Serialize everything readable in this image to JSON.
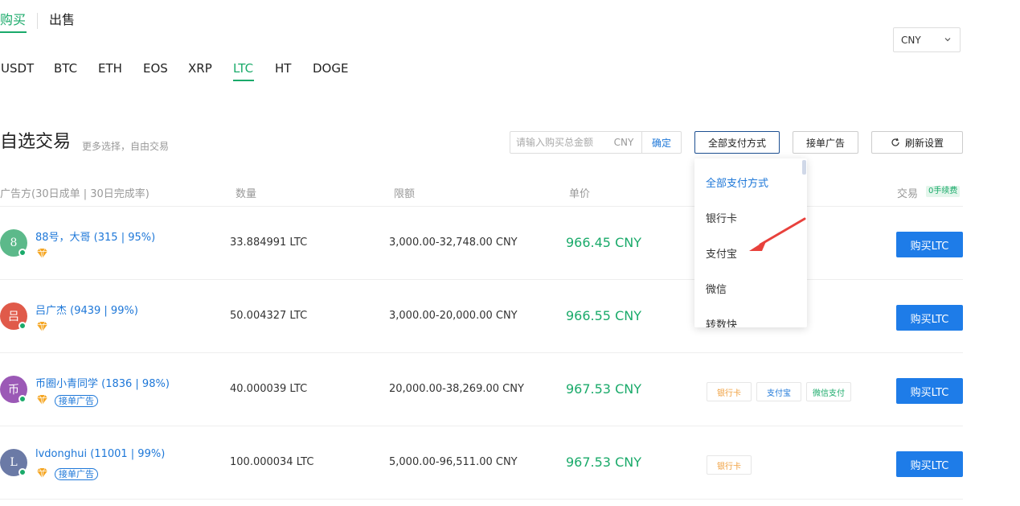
{
  "mode_tabs": {
    "buy": "购买",
    "sell": "出售"
  },
  "currency_select": {
    "value": "CNY"
  },
  "coins": [
    "USDT",
    "BTC",
    "ETH",
    "EOS",
    "XRP",
    "LTC",
    "HT",
    "DOGE"
  ],
  "active_coin": "LTC",
  "section": {
    "title": "自选交易",
    "subtitle": "更多选择，自由交易",
    "amount_placeholder": "请输入购买总金额",
    "amount_currency": "CNY",
    "confirm": "确定",
    "pay_method_button": "全部支付方式",
    "take_ad_button": "接单广告",
    "refresh_button": "刷新设置"
  },
  "table_header": {
    "advertiser": "广告方(30日成单 | 30日完成率)",
    "quantity": "数量",
    "limit": "限额",
    "price": "单价",
    "trade": "交易",
    "zero_fee": "0手续费"
  },
  "rows": [
    {
      "avatar": "8",
      "avatar_color": "#5cb98a",
      "merchant": "88号，大哥 (315 | 95%)",
      "qty": "33.884991 LTC",
      "limit": "3,000.00-32,748.00 CNY",
      "price": "966.45 CNY",
      "take_ad": "",
      "pay_tags": [],
      "buy": "购买LTC"
    },
    {
      "avatar": "吕",
      "avatar_color": "#e05a4a",
      "merchant": "吕广杰 (9439 | 99%)",
      "qty": "50.004327 LTC",
      "limit": "3,000.00-20,000.00 CNY",
      "price": "966.55 CNY",
      "take_ad": "",
      "pay_tags": [],
      "buy": "购买LTC"
    },
    {
      "avatar": "币",
      "avatar_color": "#9b59b6",
      "merchant": "币圈小青同学 (1836 | 98%)",
      "qty": "40.000039 LTC",
      "limit": "20,000.00-38,269.00 CNY",
      "price": "967.53 CNY",
      "take_ad": "接单广告",
      "pay_tags": [
        "银行卡",
        "支付宝",
        "微信支付"
      ],
      "buy": "购买LTC"
    },
    {
      "avatar": "L",
      "avatar_color": "#6b7aa6",
      "merchant": "lvdonghui (11001 | 99%)",
      "qty": "100.000034 LTC",
      "limit": "5,000.00-96,511.00 CNY",
      "price": "967.53 CNY",
      "take_ad": "接单广告",
      "pay_tags": [
        "银行卡"
      ],
      "buy": "购买LTC"
    }
  ],
  "dropdown": {
    "items": [
      "全部支付方式",
      "银行卡",
      "支付宝",
      "微信",
      "转数快"
    ]
  },
  "colors": {
    "green": "#1aaa6a",
    "blue": "#1e7ce8",
    "link": "#1d77d8"
  }
}
